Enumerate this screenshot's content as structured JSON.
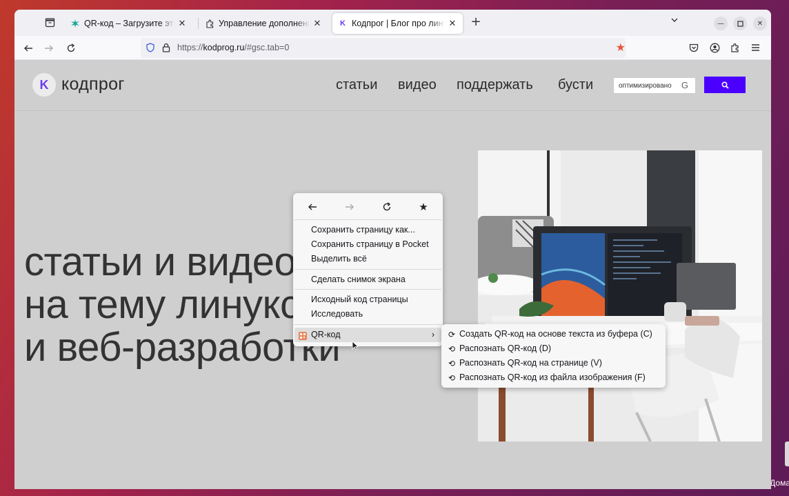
{
  "browser": {
    "tabs": [
      {
        "title": "QR-код – Загрузите это расширение",
        "active": false
      },
      {
        "title": "Управление дополнениями",
        "active": false
      },
      {
        "title": "Кодпрог | Блог про линукс",
        "active": true
      }
    ],
    "url": {
      "scheme": "https://",
      "host": "kodprog.ru",
      "path": "/#gsc.tab=0"
    },
    "bookmark_star_color": "#e8553a"
  },
  "site": {
    "logo_letter": "K",
    "logo_text": "кодпрог",
    "nav": [
      "статьи",
      "видео",
      "поддержать",
      "бусти"
    ],
    "search_placeholder": "оптимизировано",
    "search_brand": "G",
    "search_button_color": "#4b00ff",
    "hero_lines": [
      "статьи и видео",
      "на тему линукс",
      "и веб-разработки"
    ]
  },
  "context_menu": {
    "items": [
      "Сохранить страницу как...",
      "Сохранить страницу в Pocket",
      "Выделить всё",
      "Сделать снимок экрана",
      "Исходный код страницы",
      "Исследовать",
      "QR-код"
    ],
    "submenu": [
      "Создать QR-код на основе текста из буфера (C)",
      "Распознать QR-код (D)",
      "Распознать QR-код на странице (V)",
      "Распознать QR-код из файла изображения (F)"
    ]
  },
  "desktop": {
    "label": "Дома"
  }
}
